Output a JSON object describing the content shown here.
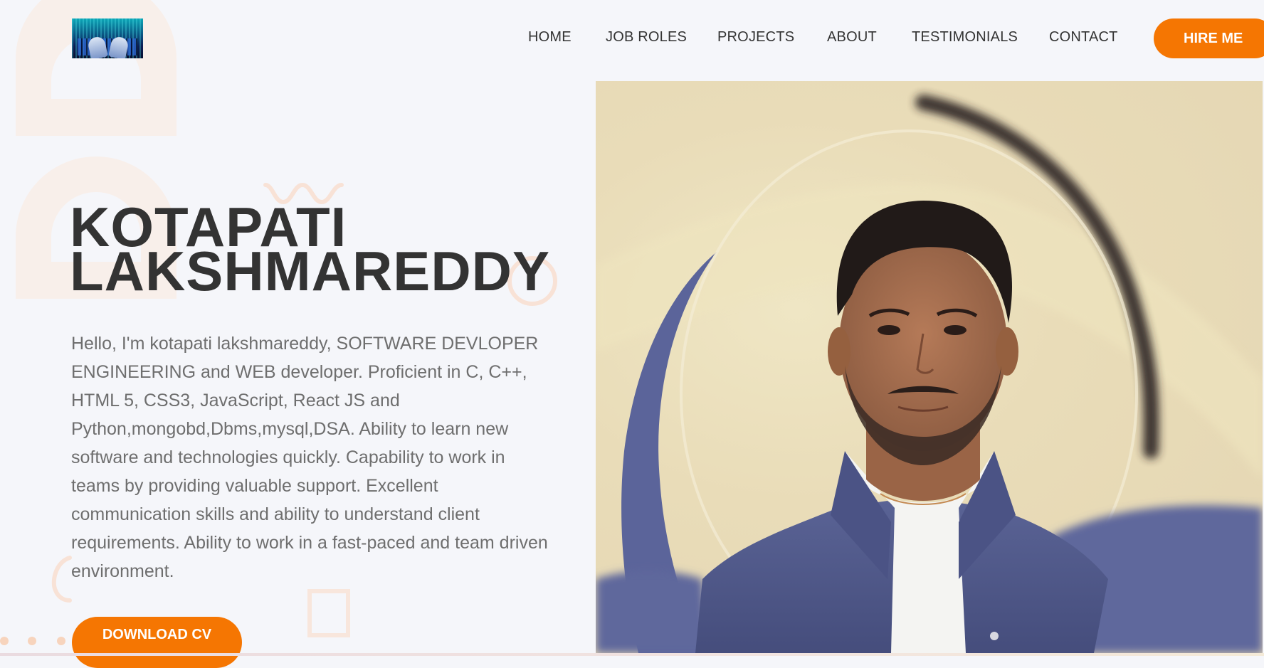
{
  "nav": {
    "logo_alt": "hands typing on a glowing keyboard logo",
    "items": [
      {
        "label": "HOME"
      },
      {
        "label": "JOB ROLES"
      },
      {
        "label": "PROJECTS"
      },
      {
        "label": "ABOUT"
      },
      {
        "label": "TESTIMONIALS"
      },
      {
        "label": "CONTACT"
      }
    ],
    "cta_label": "HIRE ME"
  },
  "hero": {
    "title_line1": "KOTAPATI",
    "title_line2": "LAKSHMAREDDY",
    "description": "Hello, I'm kotapati lakshmareddy, SOFTWARE DEVLOPER ENGINEERING and WEB developer. Proficient in C, C++, HTML 5, CSS3, JavaScript, React JS and Python,mongobd,Dbms,mysql,DSA. Ability to learn new software and technologies quickly. Capability to work in teams by providing valuable support. Excellent communication skills and ability to understand client requirements. Ability to work in a fast-paced and team driven environment.",
    "download_label": "DOWNLOAD CV",
    "photo_alt": "Portrait of Kotapati Lakshmareddy in a navy blazer with a swirl background"
  },
  "colors": {
    "accent": "#f57602",
    "heading": "#333333",
    "body_text": "#6e6e6e",
    "background": "#f5f6fa",
    "decoration": "#f8e6dc"
  }
}
